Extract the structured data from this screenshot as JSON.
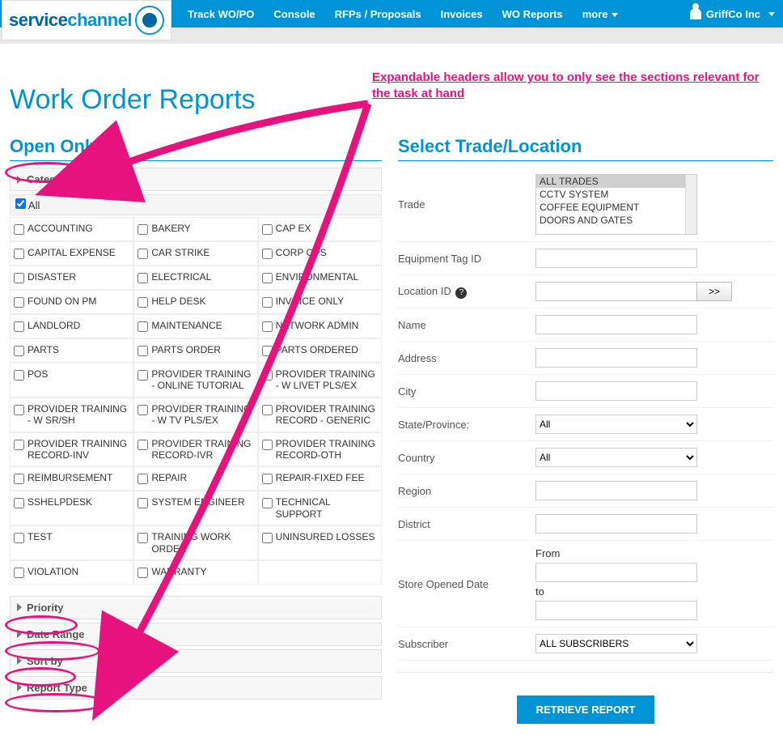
{
  "nav": {
    "items": [
      "Track WO/PO",
      "Console",
      "RFPs / Proposals",
      "Invoices",
      "WO Reports",
      "more"
    ],
    "user": "GriffCo Inc"
  },
  "logo": {
    "part1": "service",
    "part2": "channel"
  },
  "page_title": "Work Order Reports",
  "annotation": "Expandable headers allow you to only see the sections relevant for the task at hand",
  "left": {
    "title": "Open Only",
    "headers": {
      "category": "Category",
      "priority": "Priority",
      "date_range": "Date Range",
      "sort_by": "Sort by",
      "report_type": "Report Type"
    },
    "all_label": "All",
    "categories": [
      "ACCOUNTING",
      "BAKERY",
      "CAP EX",
      "CAPITAL EXPENSE",
      "CAR STRIKE",
      "CORP OPS",
      "DISASTER",
      "ELECTRICAL",
      "ENVIRONMENTAL",
      "FOUND ON PM",
      "HELP DESK",
      "INVOICE ONLY",
      "LANDLORD",
      "MAINTENANCE",
      "NETWORK ADMIN",
      "PARTS",
      "PARTS ORDER",
      "PARTS ORDERED",
      "POS",
      "PROVIDER TRAINING - ONLINE TUTORIAL",
      "PROVIDER TRAINING - W LIVET PLS/EX",
      "PROVIDER TRAINING - W SR/SH",
      "PROVIDER TRAINING - W TV PLS/EX",
      "PROVIDER TRAINING RECORD - GENERIC",
      "PROVIDER TRAINING RECORD-INV",
      "PROVIDER TRAINING RECORD-IVR",
      "PROVIDER TRAINING RECORD-OTH",
      "REIMBURSEMENT",
      "REPAIR",
      "REPAIR-FIXED FEE",
      "SSHELPDESK",
      "SYSTEM ENGINEER",
      "TECHNICAL SUPPORT",
      "TEST",
      "TRAINING WORK ORDER",
      "UNINSURED LOSSES",
      "VIOLATION",
      "WARRANTY",
      ""
    ]
  },
  "right": {
    "title": "Select Trade/Location",
    "labels": {
      "trade": "Trade",
      "equip": "Equipment Tag ID",
      "loc": "Location ID",
      "name": "Name",
      "address": "Address",
      "city": "City",
      "state": "State/Province:",
      "country": "Country",
      "region": "Region",
      "district": "District",
      "store_open": "Store Opened Date",
      "from": "From",
      "to": "to",
      "subscriber": "Subscriber"
    },
    "trade_options": [
      "ALL TRADES",
      "CCTV SYSTEM",
      "COFFEE EQUIPMENT",
      "DOORS AND GATES"
    ],
    "state_value": "All",
    "country_value": "All",
    "subscriber_value": "ALL SUBSCRIBERS",
    "go_btn": ">>",
    "help": "?",
    "retrieve": "RETRIEVE REPORT"
  }
}
